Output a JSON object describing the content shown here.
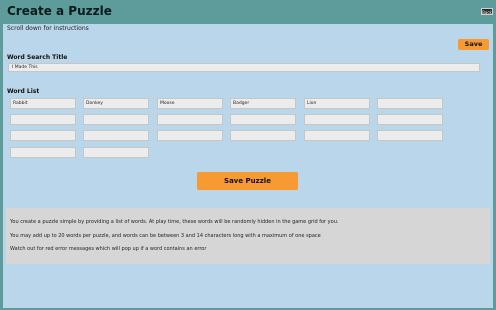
{
  "header": {
    "title": "Create a Puzzle",
    "back_label": "Back"
  },
  "hint": "Scroll down for instructions",
  "toolbar": {
    "save_label": "Save"
  },
  "title_section": {
    "label": "Word Search Title",
    "value": "I Made This"
  },
  "word_list": {
    "label": "Word List",
    "words": [
      "Rabbit",
      "Donkey",
      "Moose",
      "Badger",
      "Lion",
      "",
      "",
      "",
      "",
      "",
      "",
      "",
      "",
      "",
      "",
      "",
      "",
      "",
      "",
      ""
    ]
  },
  "save_puzzle_label": "Save Puzzle",
  "instructions": {
    "line1": "You create a puzzle simple by providing a list of words. At play time, these words will be randomly hidden in the game grid for you.",
    "line2": "You may add up to 20 words per puzzle, and words can be between 3 and 14 characters long with a maximum of one space",
    "line3": "Watch out for red error messages which will pop up if a word contains an error"
  },
  "colors": {
    "header_bg": "#5d9c9b",
    "content_bg": "#bad6ea",
    "button": "#f79a32",
    "instructions_bg": "#d6d6d6"
  }
}
